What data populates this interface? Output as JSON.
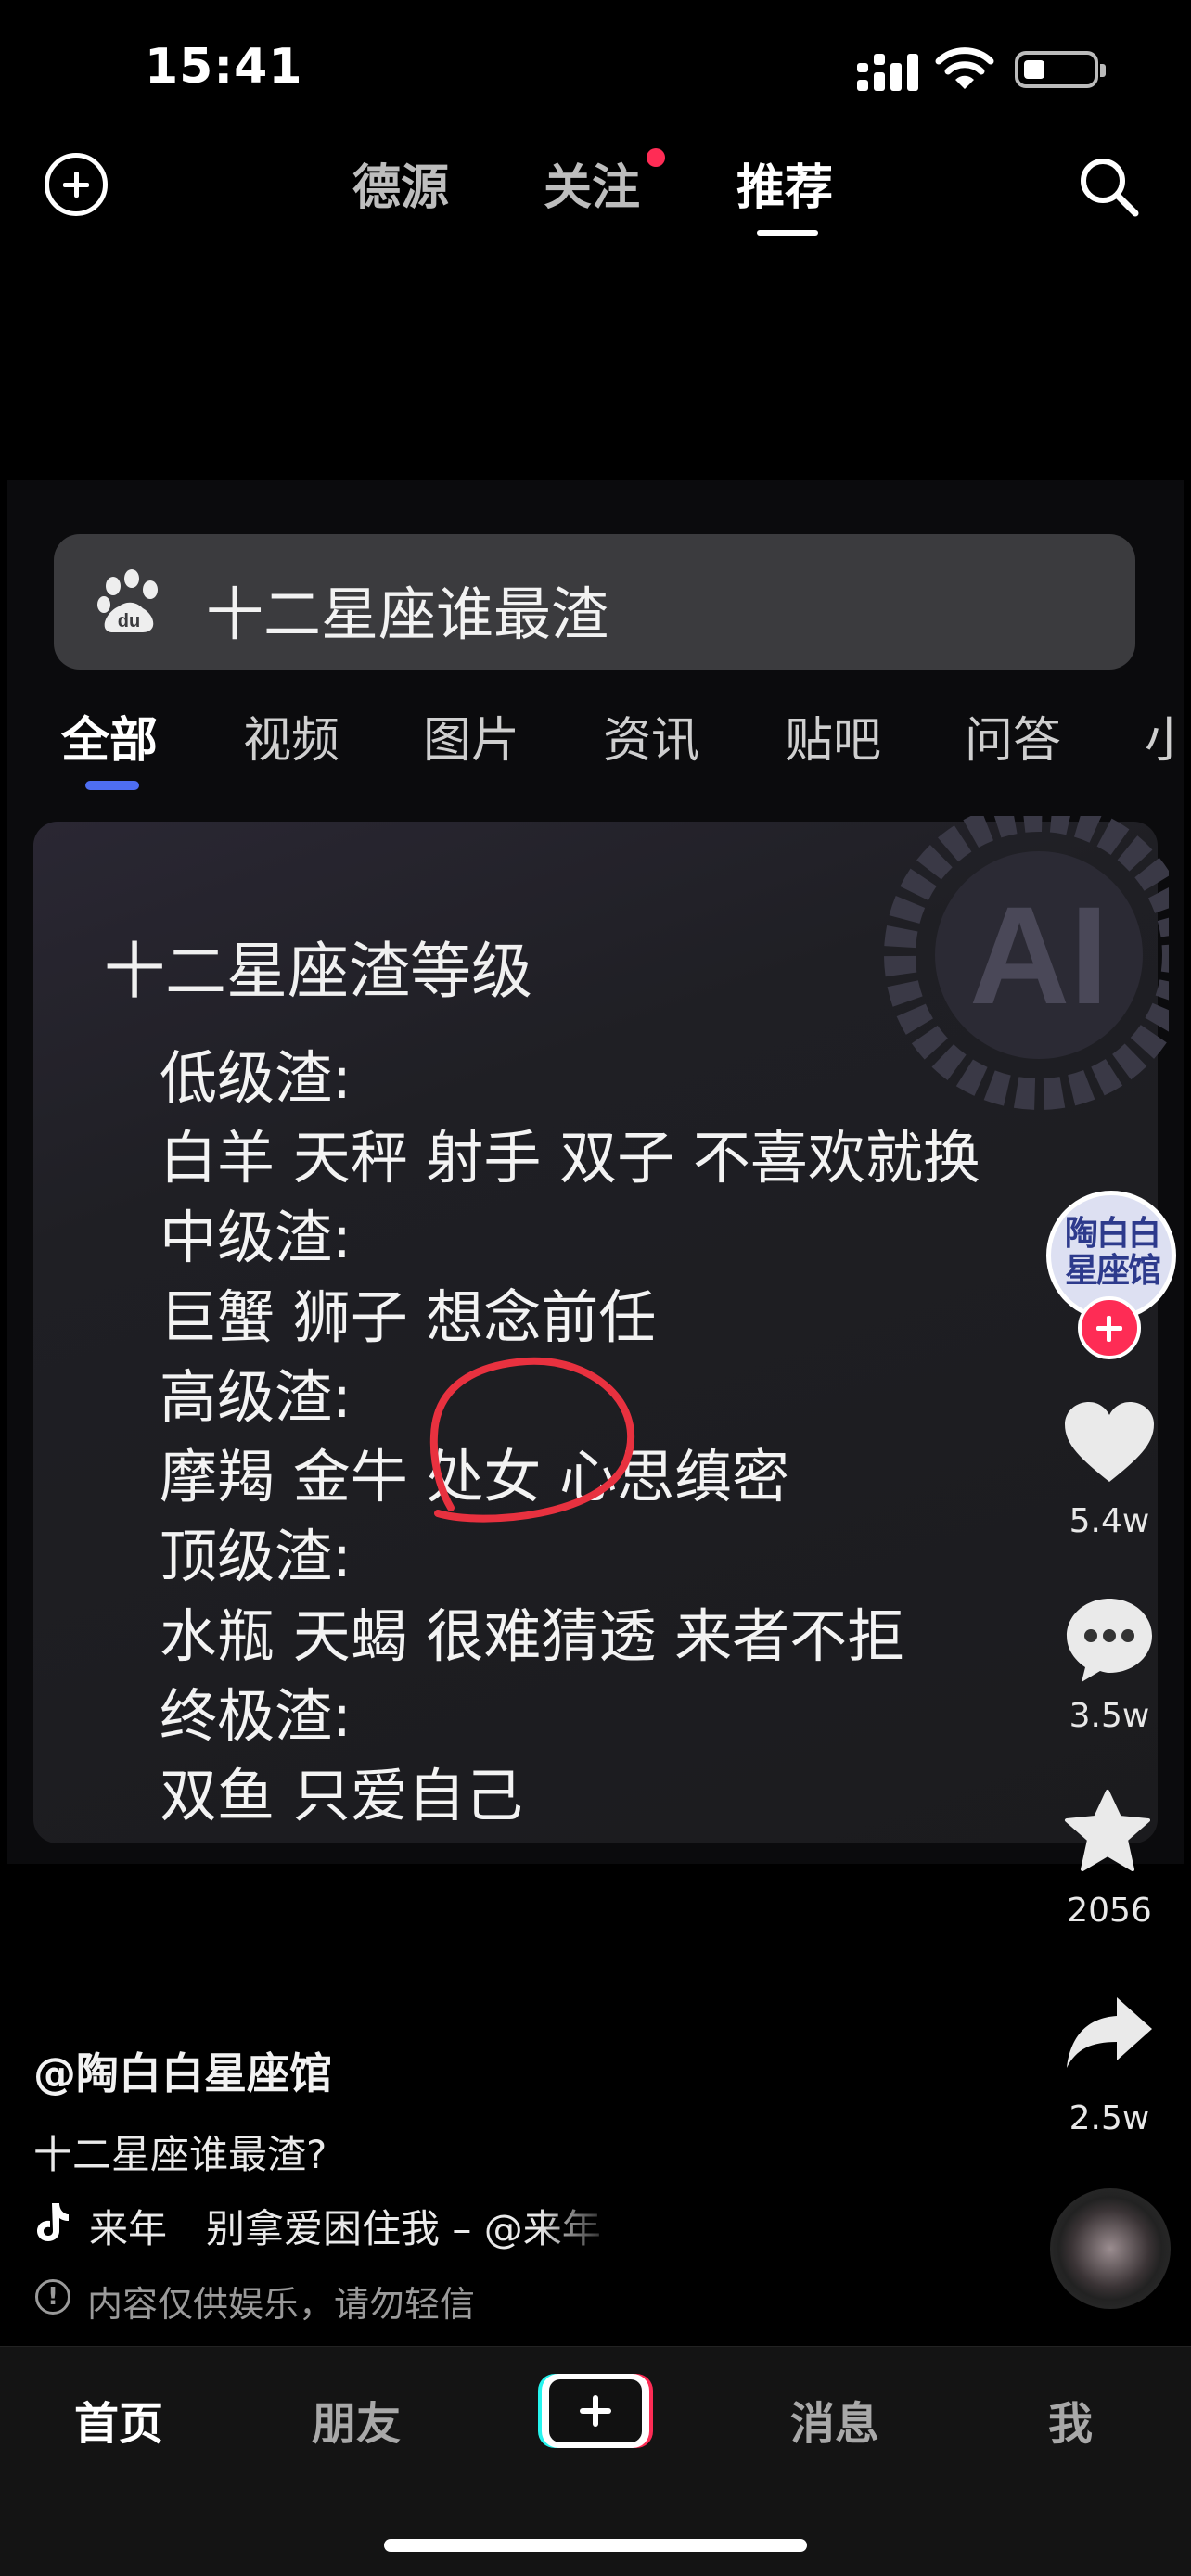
{
  "status_bar": {
    "time": "15:41"
  },
  "top_nav": {
    "tabs": [
      {
        "label": "德源"
      },
      {
        "label": "关注"
      },
      {
        "label": "推荐"
      }
    ],
    "active_tab": "推荐"
  },
  "screenshot": {
    "search_query": "十二星座谁最渣",
    "categories": [
      "全部",
      "视频",
      "图片",
      "资讯",
      "贴吧",
      "问答",
      "小"
    ],
    "active_category": "全部",
    "card": {
      "title": "十二星座渣等级",
      "lines": [
        "低级渣:",
        "白羊 天秤 射手 双子 不喜欢就换",
        "中级渣:",
        "巨蟹 狮子 想念前任",
        "高级渣:",
        "摩羯 金牛 处女 心思缜密",
        "顶级渣:",
        "水瓶 天蝎 很难猜透 来者不拒",
        "终极渣:",
        "双鱼 只爱自己"
      ],
      "watermark": "AI"
    }
  },
  "actions": {
    "avatar_text": "陶白白星座馆",
    "like_count": "5.4w",
    "comment_count": "3.5w",
    "favorite_count": "2056",
    "share_count": "2.5w"
  },
  "caption": {
    "author": "@陶白白星座馆",
    "text": "十二星座谁最渣?",
    "music": "来年　别拿爱困住我 – @来年",
    "notice": "内容仅供娱乐，请勿轻信"
  },
  "bottom_nav": {
    "home": "首页",
    "friends": "朋友",
    "messages": "消息",
    "me": "我"
  },
  "colors": {
    "accent_red": "#fe2c55",
    "baidu_blue": "#4e6ef2",
    "annotation_red": "#e8313f"
  }
}
